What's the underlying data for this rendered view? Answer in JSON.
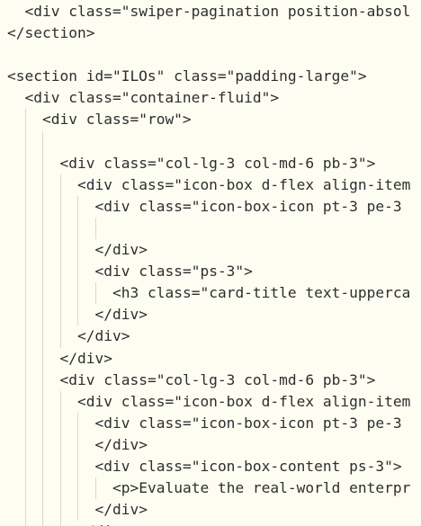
{
  "lines": [
    {
      "indent": 1,
      "text": "<div class=\"swiper-pagination position-absol"
    },
    {
      "indent": 0,
      "text": "</section>"
    },
    {
      "indent": 0,
      "text": ""
    },
    {
      "indent": 0,
      "text": "<section id=\"ILOs\" class=\"padding-large\">"
    },
    {
      "indent": 1,
      "text": "<div class=\"container-fluid\">"
    },
    {
      "indent": 2,
      "text": "<div class=\"row\">"
    },
    {
      "indent": 3,
      "text": ""
    },
    {
      "indent": 3,
      "text": "<div class=\"col-lg-3 col-md-6 pb-3\">"
    },
    {
      "indent": 4,
      "text": "<div class=\"icon-box d-flex align-item"
    },
    {
      "indent": 5,
      "text": "<div class=\"icon-box-icon pt-3 pe-3"
    },
    {
      "indent": 6,
      "text": ""
    },
    {
      "indent": 5,
      "text": "</div>"
    },
    {
      "indent": 5,
      "text": "<div class=\"ps-3\">"
    },
    {
      "indent": 6,
      "text": "<h3 class=\"card-title text-upperca"
    },
    {
      "indent": 5,
      "text": "</div>"
    },
    {
      "indent": 4,
      "text": "</div>"
    },
    {
      "indent": 3,
      "text": "</div>"
    },
    {
      "indent": 3,
      "text": "<div class=\"col-lg-3 col-md-6 pb-3\">"
    },
    {
      "indent": 4,
      "text": "<div class=\"icon-box d-flex align-item"
    },
    {
      "indent": 5,
      "text": "<div class=\"icon-box-icon pt-3 pe-3"
    },
    {
      "indent": 5,
      "text": "</div>"
    },
    {
      "indent": 5,
      "text": "<div class=\"icon-box-content ps-3\">"
    },
    {
      "indent": 6,
      "text": "<p>Evaluate the real-world enterpr"
    },
    {
      "indent": 5,
      "text": "</div>"
    },
    {
      "indent": 4,
      "text": "</div>"
    }
  ]
}
